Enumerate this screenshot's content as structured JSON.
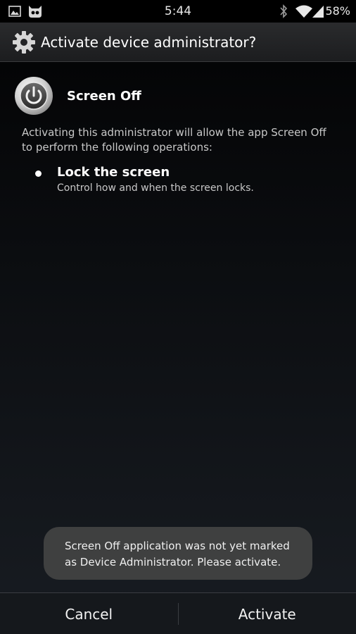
{
  "status_bar": {
    "time": "5:44",
    "battery_percent": "58%",
    "icons": [
      "picture-notification-icon",
      "cyanogen-mascot-icon",
      "bluetooth-icon",
      "wifi-icon",
      "cell-signal-icon"
    ]
  },
  "dialog": {
    "title": "Activate device administrator?",
    "title_icon": "gear-icon"
  },
  "app": {
    "name": "Screen Off",
    "icon": "power-button-icon",
    "description": "Activating this administrator will allow the app Screen Off to perform the following operations:"
  },
  "policies": [
    {
      "title": "Lock the screen",
      "description": "Control how and when the screen locks."
    }
  ],
  "toast": {
    "message": "Screen Off application was not yet marked as Device Administrator. Please activate."
  },
  "buttons": {
    "cancel_label": "Cancel",
    "activate_label": "Activate"
  }
}
